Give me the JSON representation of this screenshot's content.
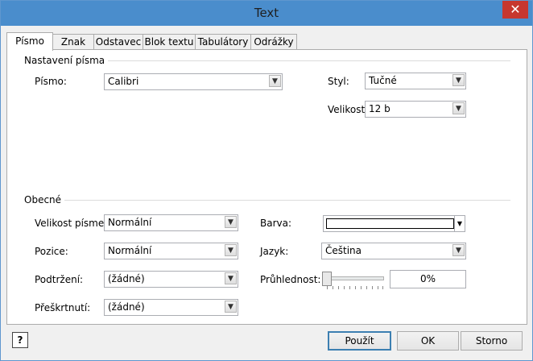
{
  "window": {
    "title": "Text",
    "close_glyph": "✕"
  },
  "tabs": [
    {
      "label": "Písmo",
      "active": true
    },
    {
      "label": "Znak"
    },
    {
      "label": "Odstavec"
    },
    {
      "label": "Blok textu"
    },
    {
      "label": "Tabulátory"
    },
    {
      "label": "Odrážky"
    }
  ],
  "font_settings": {
    "section": "Nastavení písma",
    "font_label": "Písmo:",
    "font_value": "Calibri",
    "style_label": "Styl:",
    "style_value": "Tučné",
    "size_label": "Velikost:",
    "size_value": "12 b"
  },
  "general": {
    "section": "Obecné",
    "case_label": "Velikost písmen:",
    "case_value": "Normální",
    "position_label": "Pozice:",
    "position_value": "Normální",
    "underline_label": "Podtržení:",
    "underline_value": "(žádné)",
    "strike_label": "Přeškrtnutí:",
    "strike_value": "(žádné)",
    "color_label": "Barva:",
    "color_value": "#ffffff",
    "language_label": "Jazyk:",
    "language_value": "Čeština",
    "transparency_label": "Průhlednost:",
    "transparency_value": "0%"
  },
  "buttons": {
    "apply": "Použít",
    "ok": "OK",
    "cancel": "Storno",
    "help_glyph": "?"
  }
}
